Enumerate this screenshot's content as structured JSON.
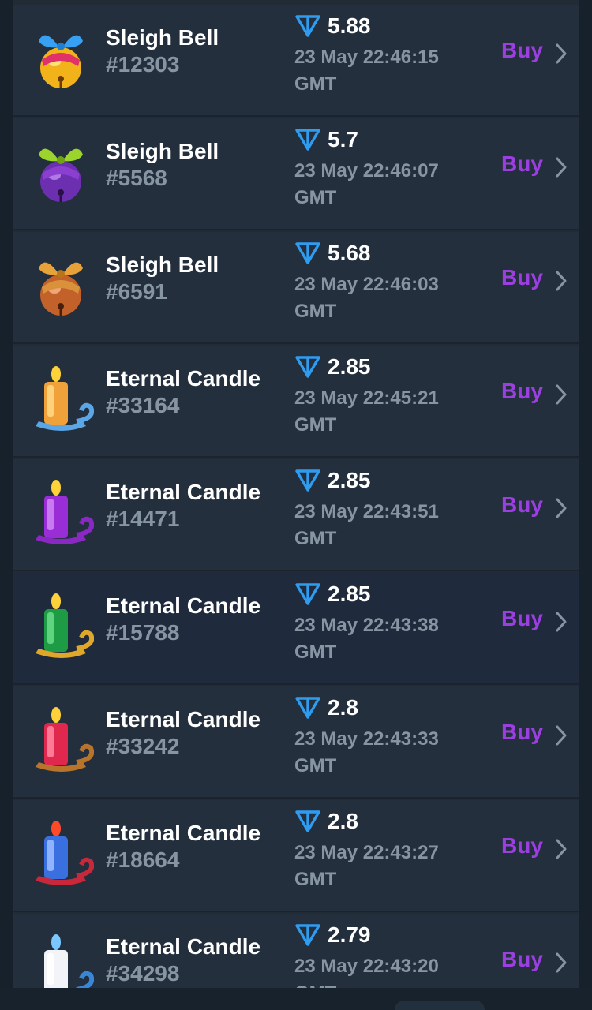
{
  "colors": {
    "background": "#17212b",
    "row": "#242f3d",
    "row_highlight": "#1f2a3c",
    "title": "#ffffff",
    "muted": "#8795a3",
    "accent_buy": "#9b3fe0",
    "ton": "#2f9cf0"
  },
  "icons": {
    "currency": "ton-icon",
    "row_action": "chevron-right-icon"
  },
  "listings": [
    {
      "name": "Sleigh Bell",
      "number": "#12303",
      "price": "5.88",
      "date_line1": "23 May 22:46:15",
      "date_line2": "GMT",
      "buy_label": "Buy",
      "thumb": "bell-blue-red"
    },
    {
      "name": "Sleigh Bell",
      "number": "#5568",
      "price": "5.7",
      "date_line1": "23 May 22:46:07",
      "date_line2": "GMT",
      "buy_label": "Buy",
      "thumb": "bell-purple-green"
    },
    {
      "name": "Sleigh Bell",
      "number": "#6591",
      "price": "5.68",
      "date_line1": "23 May 22:46:03",
      "date_line2": "GMT",
      "buy_label": "Buy",
      "thumb": "bell-bronze"
    },
    {
      "name": "Eternal Candle",
      "number": "#33164",
      "price": "2.85",
      "date_line1": "23 May 22:45:21",
      "date_line2": "GMT",
      "buy_label": "Buy",
      "thumb": "candle-orange"
    },
    {
      "name": "Eternal Candle",
      "number": "#14471",
      "price": "2.85",
      "date_line1": "23 May 22:43:51",
      "date_line2": "GMT",
      "buy_label": "Buy",
      "thumb": "candle-purple"
    },
    {
      "name": "Eternal Candle",
      "number": "#15788",
      "price": "2.85",
      "date_line1": "23 May 22:43:38",
      "date_line2": "GMT",
      "buy_label": "Buy",
      "thumb": "candle-green"
    },
    {
      "name": "Eternal Candle",
      "number": "#33242",
      "price": "2.8",
      "date_line1": "23 May 22:43:33",
      "date_line2": "GMT",
      "buy_label": "Buy",
      "thumb": "candle-red"
    },
    {
      "name": "Eternal Candle",
      "number": "#18664",
      "price": "2.8",
      "date_line1": "23 May 22:43:27",
      "date_line2": "GMT",
      "buy_label": "Buy",
      "thumb": "candle-blue"
    },
    {
      "name": "Eternal Candle",
      "number": "#34298",
      "price": "2.79",
      "date_line1": "23 May 22:43:20",
      "date_line2": "GMT",
      "buy_label": "Buy",
      "thumb": "candle-white"
    }
  ]
}
